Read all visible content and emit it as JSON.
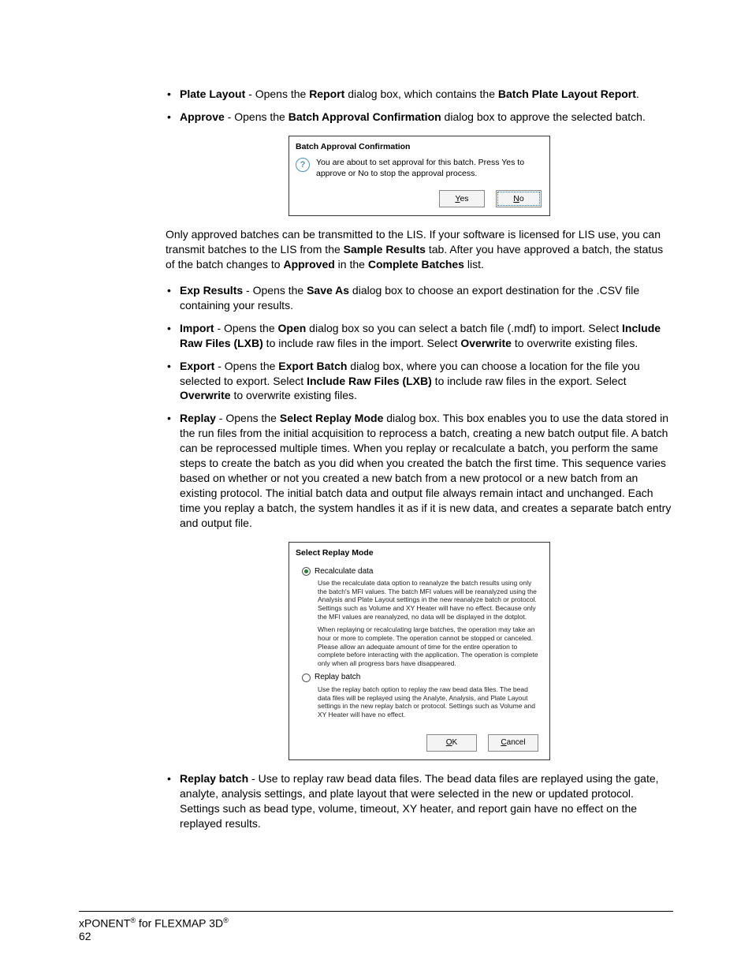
{
  "bullets_top": {
    "plate_layout": {
      "label": "Plate Layout",
      "t1": " - Opens the ",
      "b1": "Report",
      "t2": " dialog box, which contains the ",
      "b2": "Batch Plate Layout Report",
      "t3": "."
    },
    "approve": {
      "label": "Approve",
      "t1": " - Opens the ",
      "b1": "Batch Approval Confirmation",
      "t2": " dialog box to approve the selected batch."
    }
  },
  "approval_dialog": {
    "title": "Batch Approval Confirmation",
    "message": "You are about to set approval for this batch.  Press Yes to approve or No to stop the approval process.",
    "yes": "Yes",
    "no": "No"
  },
  "mid_paragraph": {
    "t1": "Only approved batches can be transmitted to the LIS. If your software is licensed for LIS use, you can transmit batches to the LIS from the ",
    "b1": "Sample Results",
    "t2": " tab. After you have approved a batch, the status of the batch changes to ",
    "b2": "Approved",
    "t3": " in the ",
    "b3": "Complete Batches",
    "t4": " list."
  },
  "bullets_mid": {
    "exp": {
      "label": "Exp Results",
      "t1": " - Opens the ",
      "b1": "Save As",
      "t2": " dialog box to choose an export destination for the .CSV file containing your results."
    },
    "import": {
      "label": "Import",
      "t1": " - Opens the ",
      "b1": "Open",
      "t2": " dialog box so you can select a batch file (.mdf) to import. Select ",
      "b2": "Include Raw Files (LXB)",
      "t3": " to include raw files in the import. Select ",
      "b3": "Overwrite",
      "t4": " to overwrite existing files."
    },
    "export": {
      "label": "Export",
      "t1": " - Opens the ",
      "b1": "Export Batch",
      "t2": " dialog box, where you can choose a location for the file you selected to export. Select ",
      "b2": "Include Raw Files (LXB)",
      "t3": " to include raw files in the export. Select ",
      "b3": "Overwrite",
      "t4": " to overwrite existing files."
    },
    "replay": {
      "label": "Replay",
      "t1": " - Opens the ",
      "b1": "Select Replay Mode",
      "t2": " dialog box. This box enables you to use the data stored in the run files from the initial acquisition to reprocess a batch, creating a new batch output file. A batch can be reprocessed multiple times. When you replay or recalculate a batch, you perform the same steps to create the batch as you did when you created the batch the first time. This sequence varies based on whether or not you created a new batch from a new protocol or a new batch from an existing protocol. The initial batch data and output file always remain intact and unchanged. Each time you replay a batch, the system handles it as if it is new data, and creates a separate batch entry and output file."
    }
  },
  "replay_dialog": {
    "title": "Select Replay Mode",
    "opt1_label": "Recalculate data",
    "opt1_desc1": "Use the recalculate data option to reanalyze the batch results using only the batch's MFI values.  The batch MFI values will be reanalyzed using the Analysis and Plate Layout settings in the new reanalyze batch or protocol.  Settings such as Volume and XY Heater will have no effect.  Because only the MFI values are reanalyzed, no data will be displayed in the dotplot.",
    "opt1_desc2": "When replaying or recalculating large batches, the operation may take an hour or more to complete.  The operation cannot be stopped or canceled.  Please allow an adequate amount of time for the entire operation to complete before interacting with the application.  The operation is complete only when all progress bars have disappeared.",
    "opt2_label": "Replay batch",
    "opt2_desc": "Use the replay batch option to replay the raw bead data files.  The bead data files will be replayed using the Analyte, Analysis, and Plate Layout settings in the new replay batch or protocol.  Settings such as Volume and XY Heater will have no effect.",
    "ok": "OK",
    "cancel": "Cancel"
  },
  "bullets_bottom": {
    "replay_batch": {
      "label": "Replay batch",
      "text": " - Use to replay raw bead data files. The bead data files are replayed using the gate, analyte, analysis settings, and plate layout that were selected in the new or updated protocol. Settings such as bead type, volume, timeout, XY heater, and report gain have no effect on the replayed results."
    }
  },
  "footer": {
    "product1": "xPONENT",
    "for": " for ",
    "product2": "FLEXMAP 3D",
    "reg": "®",
    "page": "62"
  }
}
